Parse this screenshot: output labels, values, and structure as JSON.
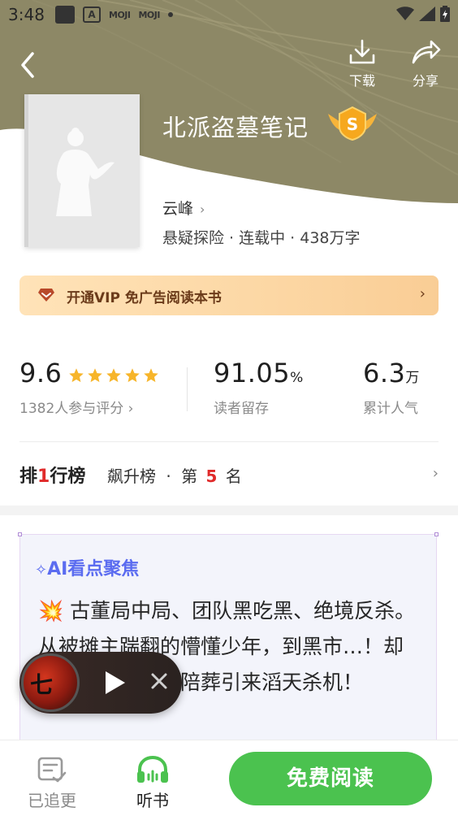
{
  "status_bar": {
    "time": "3:48",
    "icons": [
      "app-square-icon",
      "a-icon",
      "moji-icon",
      "moji-icon",
      "dot-icon"
    ],
    "moji_label_1": "MOJI",
    "moji_label_2": "MOJI",
    "a_label": "A"
  },
  "header": {
    "download_label": "下载",
    "share_label": "分享"
  },
  "book": {
    "title": "北派盗墓笔记",
    "badge": "S",
    "author": "云峰",
    "meta": "悬疑探险 · 连载中 · 438万字"
  },
  "vip_banner": {
    "text": "开通VIP 免广告阅读本书",
    "chevron": "›"
  },
  "stats": {
    "rating": {
      "value": "9.6",
      "stars": 5,
      "label": "1382人参与评分 ›"
    },
    "retention": {
      "value": "91.05",
      "unit": "%",
      "label": "读者留存"
    },
    "popularity": {
      "value": "6.3",
      "unit": "万",
      "label": "累计人气"
    }
  },
  "ranking": {
    "title_a": "排",
    "title_b": "行榜",
    "title_red": "1",
    "board": "飙升榜",
    "sep": "·",
    "prefix": "第",
    "position": "5",
    "suffix": "名",
    "chevron": "›"
  },
  "ai_focus": {
    "title": "AI看点聚焦",
    "emoji": "💥",
    "text": "古董局中局、团队黑吃黑、绝境反杀。从被摊主踹翻的懵懂少年，到黑市…！却因墓中一缸神秘陪葬引来滔天杀机！"
  },
  "player": {
    "art_char": "七"
  },
  "bottom_bar": {
    "followed_label": "已追更",
    "listen_label": "听书",
    "read_label": "免费阅读"
  },
  "colors": {
    "hero_olive": "#8d8866",
    "green": "#4bc24f",
    "vip_text": "#6b3b1a",
    "ai_title": "#5b6cf0",
    "rank_red": "#e02a2a"
  }
}
